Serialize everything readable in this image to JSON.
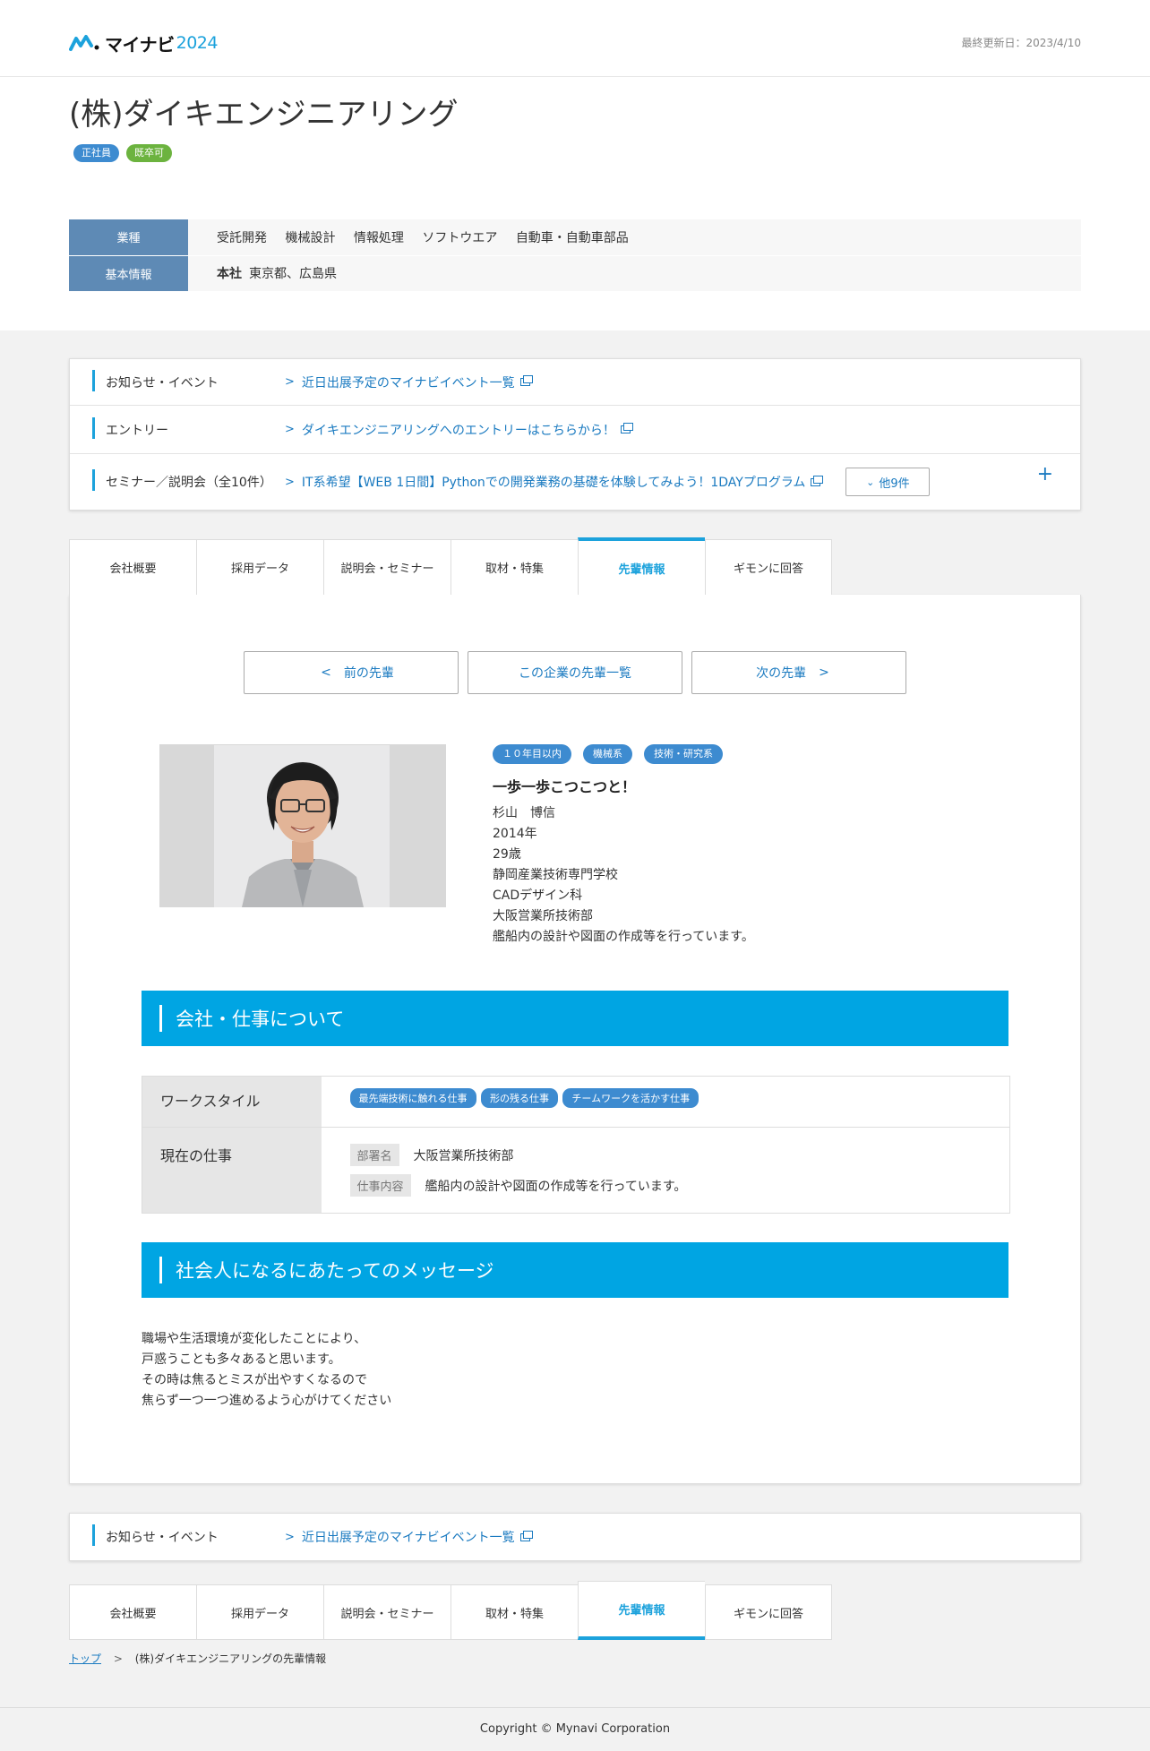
{
  "header": {
    "logo_text": "マイナビ",
    "logo_year": "2024",
    "updated_label": "最終更新日：",
    "updated_date": "2023/4/10"
  },
  "company": {
    "name": "(株)ダイキエンジニアリング",
    "tags": [
      "正社員",
      "既卒可"
    ],
    "industry_label": "業種",
    "industries": [
      "受託開発",
      "機械設計",
      "情報処理",
      "ソフトウエア",
      "自動車・自動車部品"
    ],
    "basic_label": "基本情報",
    "hq_label": "本社",
    "hq_value": "東京都、広島県"
  },
  "links": {
    "news_label": "お知らせ・イベント",
    "news_link": "近日出展予定のマイナビイベント一覧",
    "entry_label": "エントリー",
    "entry_link": "ダイキエンジニアリングへのエントリーはこちらから！",
    "seminar_label": "セミナー／説明会（全10件）",
    "seminar_link": "IT系希望【WEB 1日間】Pythonでの開発業務の基礎を体験してみよう！1DAYプログラム",
    "seminar_more": "他9件",
    "plus": "+"
  },
  "tabs": [
    "会社概要",
    "採用データ",
    "説明会・セミナー",
    "取材・特集",
    "先輩情報",
    "ギモンに回答"
  ],
  "nav": {
    "prev": "前の先輩",
    "list": "この企業の先輩一覧",
    "next": "次の先輩"
  },
  "profile": {
    "tags": [
      "１０年目以内",
      "機械系",
      "技術・研究系"
    ],
    "catch": "一歩一歩こつこつと！",
    "name": "杉山　博信",
    "year": "2014年",
    "age": "29歳",
    "school": "静岡産業技術専門学校",
    "department": "CADデザイン科",
    "office": "大阪営業所技術部",
    "work": "艦船内の設計や図面の作成等を行っています。"
  },
  "section1": {
    "title": "会社・仕事について",
    "workstyle_label": "ワークスタイル",
    "workstyle_tags": [
      "最先端技術に触れる仕事",
      "形の残る仕事",
      "チームワークを活かす仕事"
    ],
    "current_label": "現在の仕事",
    "dept_label": "部署名",
    "dept_value": "大阪営業所技術部",
    "job_label": "仕事内容",
    "job_value": "艦船内の設計や図面の作成等を行っています。"
  },
  "section2": {
    "title": "社会人になるにあたってのメッセージ",
    "lines": [
      "職場や生活環境が変化したことにより、",
      "戸惑うことも多々あると思います。",
      "その時は焦るとミスが出やすくなるので",
      "焦らず一つ一つ進めるよう心がけてください"
    ]
  },
  "breadcrumb": {
    "top": "トップ",
    "sep": ">",
    "current": "(株)ダイキエンジニアリングの先輩情報"
  },
  "footer": {
    "copyright": "Copyright © Mynavi Corporation"
  },
  "colors": {
    "accent": "#1ca2dc",
    "section_head": "#00a5e3",
    "tag_blue": "#3d8bd0",
    "tag_green": "#6cb33f",
    "table_head": "#5e8ab5"
  }
}
